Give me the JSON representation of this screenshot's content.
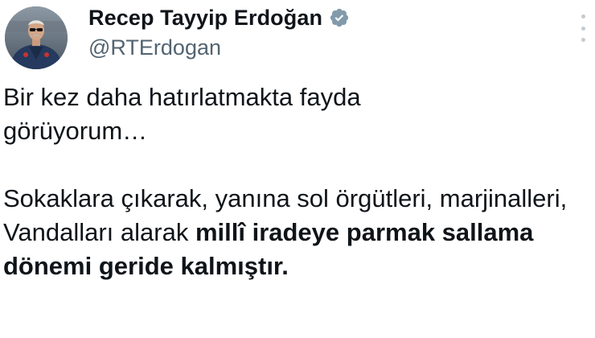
{
  "author": {
    "display_name": "Recep Tayyip Erdoğan",
    "handle": "@RTErdogan",
    "verified": true,
    "verified_badge_color": "#829aab"
  },
  "tweet": {
    "paragraph1": "Bir kez daha hatırlatmakta fayda görüyorum…",
    "paragraph2_regular": "Sokaklara çıkarak, yanına sol örgütleri, marjinalleri, Vandalları alarak ",
    "paragraph2_bold": "millî iradeye parmak sallama dönemi geride kalmıştır."
  },
  "icons": {
    "more": "more-options-icon",
    "verified": "verified-badge-icon"
  },
  "colors": {
    "text": "#0f1419",
    "secondary_text": "#536471",
    "background": "#ffffff"
  }
}
